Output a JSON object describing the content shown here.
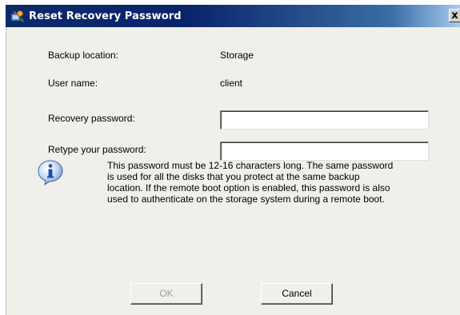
{
  "window": {
    "title": "Reset Recovery Password",
    "close_glyph": "x"
  },
  "form": {
    "backup_location_label": "Backup location:",
    "backup_location_value": "Storage",
    "user_name_label": "User name:",
    "user_name_value": "client",
    "recovery_password_label": "Recovery password:",
    "recovery_password_value": "",
    "retype_password_label": "Retype your password:",
    "retype_password_value": ""
  },
  "info": {
    "icon": "info-icon",
    "line1": "This password must be 12-16 characters long. The same password",
    "line2": "is used for all the disks that you protect at the same backup",
    "line3": "location. If the remote boot option is enabled, this password is also",
    "line4": "used to authenticate on the storage system during a remote boot."
  },
  "buttons": {
    "ok_label": "OK",
    "ok_enabled": false,
    "cancel_label": "Cancel"
  },
  "colors": {
    "titlebar_start": "#0a246a",
    "titlebar_end": "#a6caf0",
    "dialog_bg": "#f0efea",
    "disabled_text": "#a0a0a0"
  }
}
